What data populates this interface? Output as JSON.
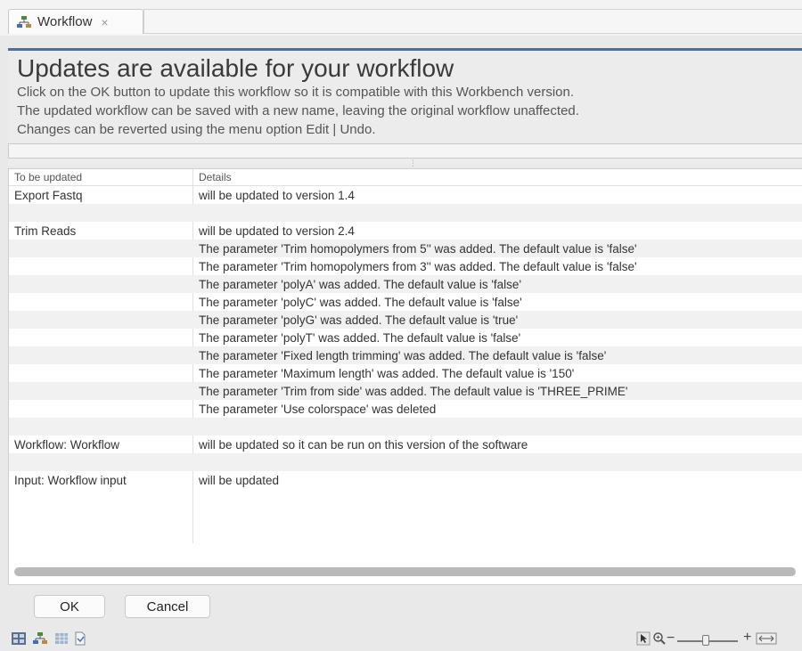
{
  "tab": {
    "label": "Workflow",
    "close_glyph": "×",
    "icon": "workflow-icon"
  },
  "header": {
    "title": "Updates are available for your workflow",
    "lines": [
      "Click on the OK button to update this workflow so it is compatible with this Workbench version.",
      "The updated workflow can be saved with a new name, leaving the original workflow unaffected.",
      "Changes can be reverted using the menu option Edit | Undo."
    ]
  },
  "table": {
    "columns": [
      "To be updated",
      "Details"
    ],
    "rows": [
      {
        "item": "Export Fastq",
        "detail": "will be updated to version 1.4"
      },
      {
        "item": "",
        "detail": ""
      },
      {
        "item": "Trim Reads",
        "detail": "will be updated to version 2.4"
      },
      {
        "item": "",
        "detail": "The parameter 'Trim homopolymers from 5'' was added. The default value is 'false'"
      },
      {
        "item": "",
        "detail": "The parameter 'Trim homopolymers from 3'' was added. The default value is 'false'"
      },
      {
        "item": "",
        "detail": "The parameter 'polyA' was added. The default value is 'false'"
      },
      {
        "item": "",
        "detail": "The parameter 'polyC' was added. The default value is 'false'"
      },
      {
        "item": "",
        "detail": "The parameter 'polyG' was added. The default value is 'true'"
      },
      {
        "item": "",
        "detail": "The parameter 'polyT' was added. The default value is 'false'"
      },
      {
        "item": "",
        "detail": "The parameter 'Fixed length trimming' was added. The default value is 'false'"
      },
      {
        "item": "",
        "detail": "The parameter 'Maximum length' was added. The default value is '150'"
      },
      {
        "item": "",
        "detail": "The parameter 'Trim from side' was added. The default value is 'THREE_PRIME'"
      },
      {
        "item": "",
        "detail": "The parameter 'Use colorspace' was deleted"
      },
      {
        "item": "",
        "detail": ""
      },
      {
        "item": "Workflow: Workflow",
        "detail": "will be updated so it can be run on this version of the software"
      },
      {
        "item": "",
        "detail": ""
      },
      {
        "item": "Input: Workflow input",
        "detail": "will be updated"
      }
    ]
  },
  "buttons": {
    "ok": "OK",
    "cancel": "Cancel"
  },
  "statusbar": {
    "zoom_out": "−",
    "zoom_in": "+",
    "accent_color": "#4f6e9c"
  }
}
